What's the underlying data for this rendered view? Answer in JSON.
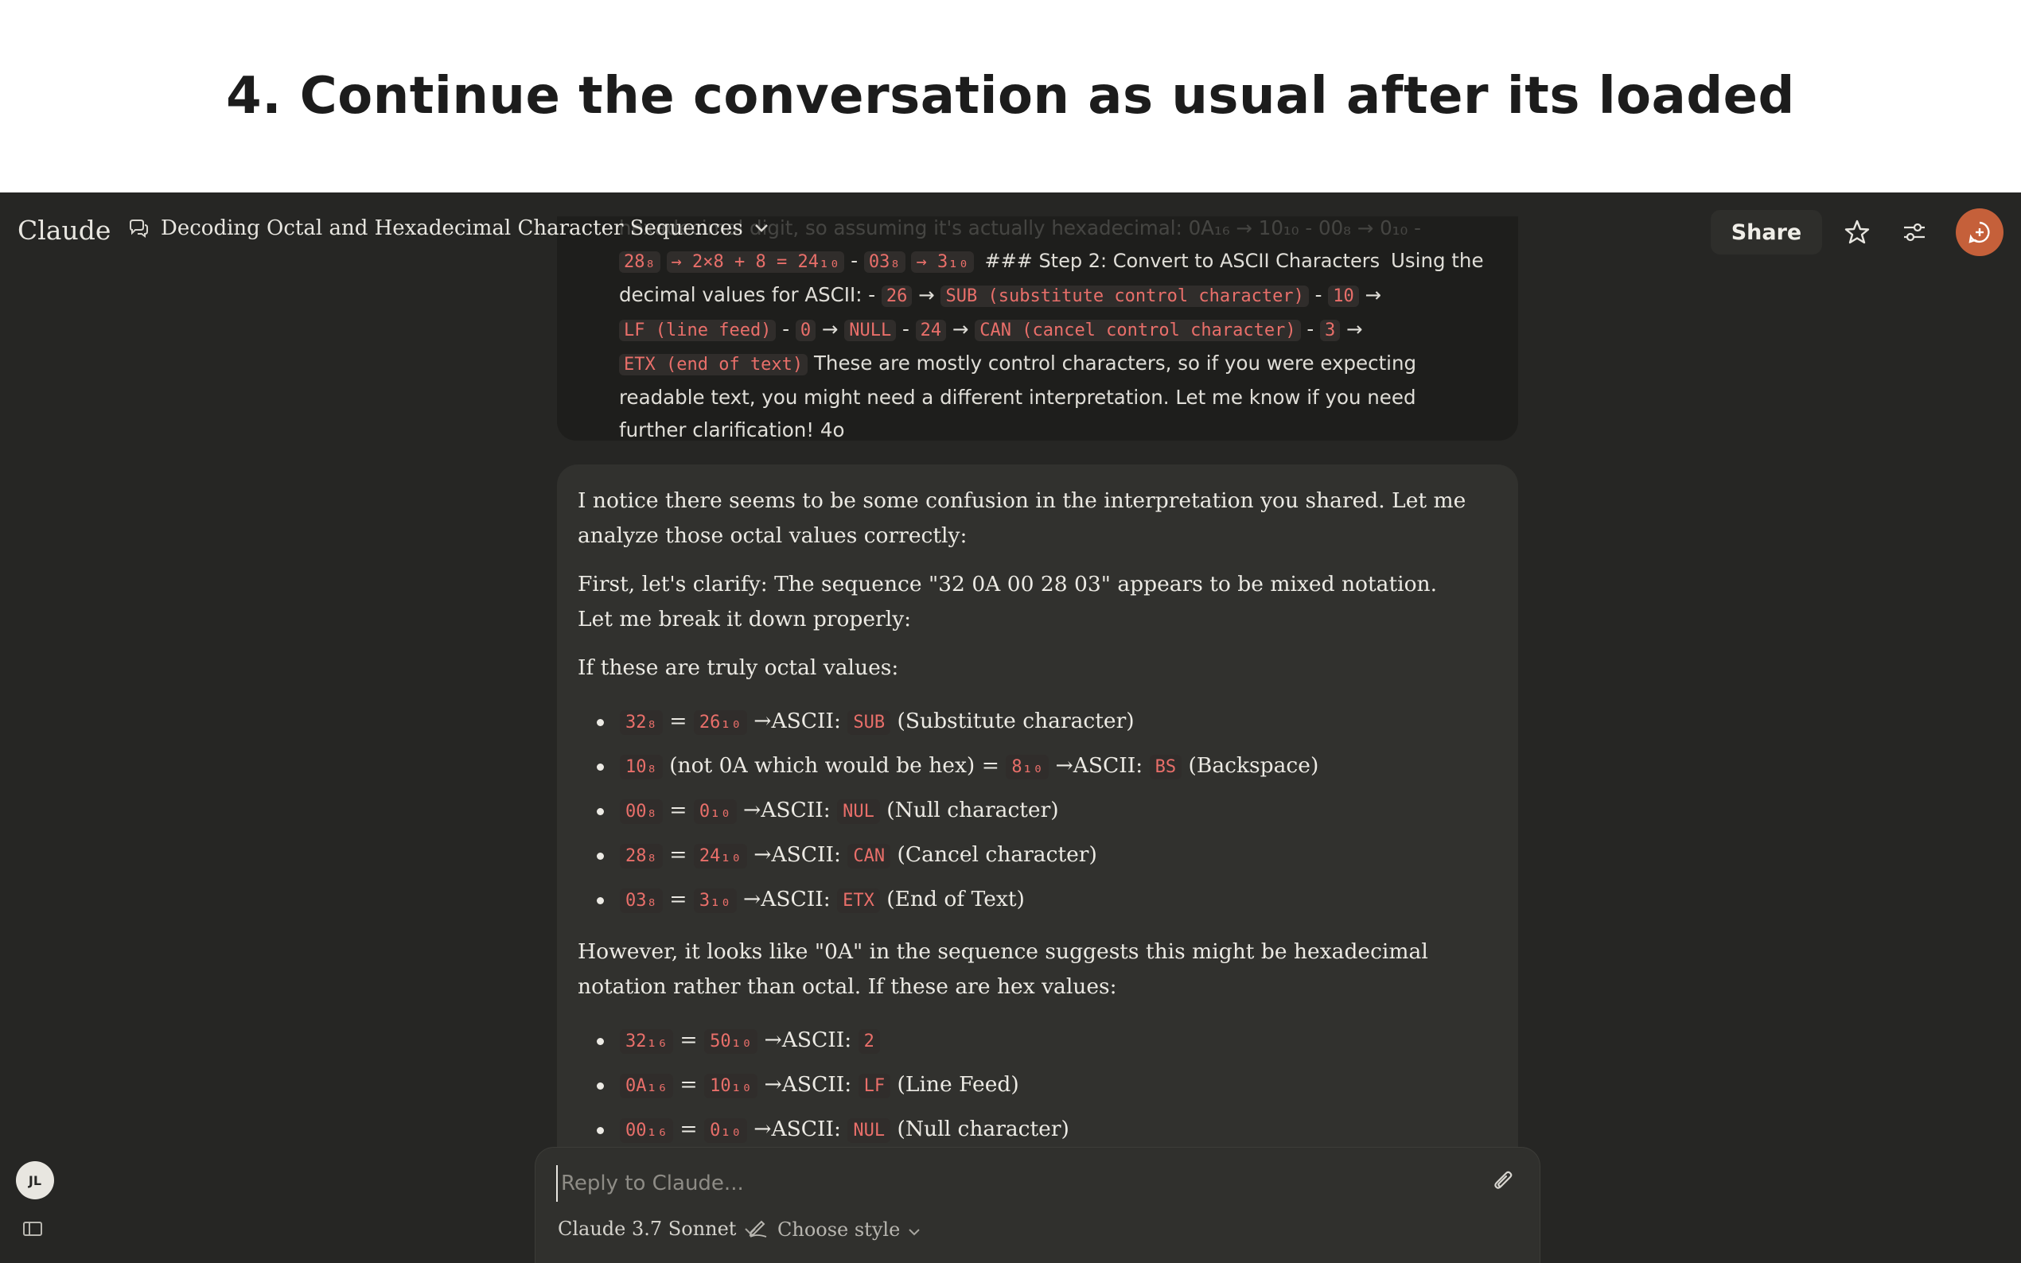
{
  "banner": {
    "title": "4. Continue the conversation as usual after its loaded"
  },
  "header": {
    "brand": "Claude",
    "chat_title": "Decoding Octal and Hexadecimal Character Sequences",
    "share_label": "Share",
    "icons": [
      "chat-bubble-icon",
      "chevron-down-icon",
      "star-icon",
      "sliders-icon",
      "new-chat-icon"
    ]
  },
  "user_message": {
    "faded_line": "hexadecimal digit, so assuming it's actually hexadecimal:  0A₁₆  →  10₁₀  -  00₈  →  0₁₀  -",
    "parts": {
      "c1": "28₈",
      "c2": "→ 2×8 + 8 = 24₁₀",
      "c3": "03₈",
      "c4": "→ 3₁₀",
      "c5": "### Step 2: Convert to ASCII Characters",
      "t1": "Using the decimal values for ASCII: -",
      "c6": "26",
      "c7": "SUB (substitute control character)",
      "c8": "10",
      "c9": "LF (line feed)",
      "c10": "0",
      "c11": "NULL",
      "c12": "24",
      "c13": "CAN (cancel control character)",
      "c14": "3",
      "c15": "ETX (end of text)",
      "t2": "These are mostly control characters, so if you were expecting readable text, you might need a different interpretation. Let me know if you need further clarification!  4o"
    }
  },
  "assistant_message": {
    "p1": "I notice there seems to be some confusion in the interpretation you shared. Let me analyze those octal values correctly:",
    "p2": "First, let's clarify: The sequence \"32 0A 00 28 03\" appears to be mixed notation. Let me break it down properly:",
    "p3": "If these are truly octal values:",
    "octal_items": [
      {
        "a": "32₈",
        "b": "26₁₀",
        "arrow": "→ASCII:",
        "c": "SUB",
        "desc": "(Substitute character)",
        "mid": "="
      },
      {
        "a": "10₈",
        "b": "8₁₀",
        "arrow": "→ASCII:",
        "c": "BS",
        "desc": "(Backspace)",
        "mid": "(not 0A which would be hex) ="
      },
      {
        "a": "00₈",
        "b": "0₁₀",
        "arrow": "→ASCII:",
        "c": "NUL",
        "desc": "(Null character)",
        "mid": "="
      },
      {
        "a": "28₈",
        "b": "24₁₀",
        "arrow": "→ASCII:",
        "c": "CAN",
        "desc": "(Cancel character)",
        "mid": "="
      },
      {
        "a": "03₈",
        "b": "3₁₀",
        "arrow": "→ASCII:",
        "c": "ETX",
        "desc": "(End of Text)",
        "mid": "="
      }
    ],
    "p4": "However, it looks like \"0A\" in the sequence suggests this might be hexadecimal notation rather than octal. If these are hex values:",
    "hex_items": [
      {
        "a": "32₁₆",
        "b": "50₁₀",
        "arrow": "→ASCII:",
        "c": "2",
        "desc": "",
        "mid": "="
      },
      {
        "a": "0A₁₆",
        "b": "10₁₀",
        "arrow": "→ASCII:",
        "c": "LF",
        "desc": "(Line Feed)",
        "mid": "="
      },
      {
        "a": "00₁₆",
        "b": "0₁₀",
        "arrow": "→ASCII:",
        "c": "NUL",
        "desc": "(Null character)",
        "mid": "="
      }
    ]
  },
  "sidebar": {
    "user_initials": "JL"
  },
  "composer": {
    "placeholder": "Reply to Claude...",
    "model": "Claude 3.7 Sonnet",
    "style": "Choose style"
  },
  "colors": {
    "app_bg": "#262624",
    "card_bg": "#31312e",
    "code_text": "#e96f6a",
    "accent": "#c5603a"
  }
}
